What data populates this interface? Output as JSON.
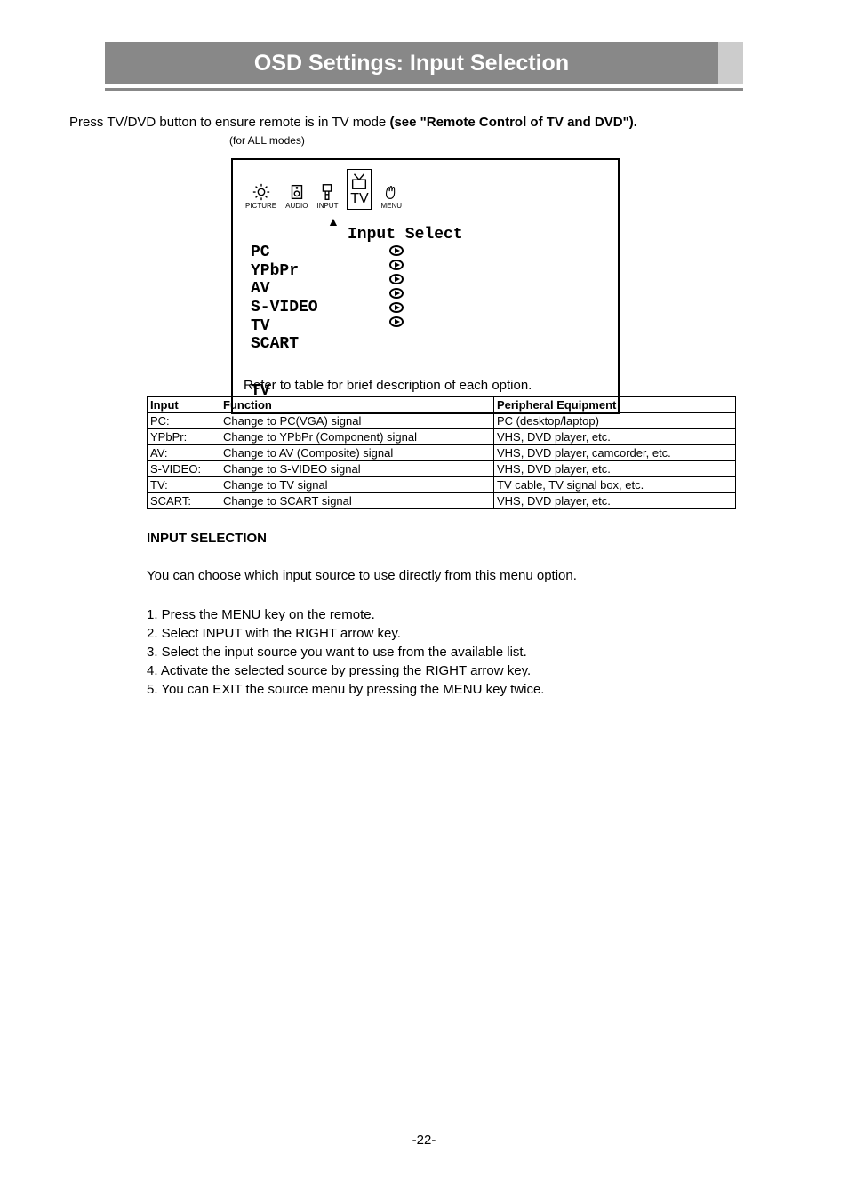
{
  "header": {
    "title": "OSD Settings: Input Selection"
  },
  "intro": {
    "prefix": "Press TV/DVD button to ensure remote is in TV mode ",
    "bold": "(see \"Remote Control of TV and DVD\").",
    "all_modes": "(for ALL modes)"
  },
  "osd": {
    "icons": {
      "picture": "PICTURE",
      "audio": "AUDIO",
      "input": "INPUT",
      "tv": "TV",
      "menu": "MENU"
    },
    "triangle": "▲",
    "heading": "Input Select",
    "items": [
      "PC",
      "YPbPr",
      "AV",
      "S-VIDEO",
      "TV",
      "SCART"
    ],
    "status": "TV"
  },
  "caption": "Refer to table for brief description of each option.",
  "table": {
    "headers": [
      "Input",
      "Function",
      "Peripheral Equipment"
    ],
    "rows": [
      [
        "PC:",
        "Change to PC(VGA) signal",
        "PC (desktop/laptop)"
      ],
      [
        "YPbPr:",
        "Change to YPbPr (Component) signal",
        "VHS, DVD player, etc."
      ],
      [
        "AV:",
        "Change to AV  (Composite) signal",
        "VHS, DVD player, camcorder, etc."
      ],
      [
        "S-VIDEO:",
        "Change to S-VIDEO signal",
        "VHS, DVD player, etc."
      ],
      [
        "TV:",
        "Change to TV signal",
        "TV cable, TV signal box, etc."
      ],
      [
        "SCART:",
        "Change to SCART signal",
        "VHS, DVD player, etc."
      ]
    ]
  },
  "section": {
    "title": "INPUT SELECTION",
    "desc": "You can choose which input source to use directly from this menu option.",
    "steps": [
      "1.  Press the MENU key on the remote.",
      "2.  Select INPUT with the RIGHT arrow key.",
      "3.  Select the input source you want to use from the available list.",
      "4.  Activate the selected source by pressing the RIGHT arrow key.",
      "5.  You can EXIT the source menu by pressing the MENU key twice."
    ]
  },
  "page_number": "-22-"
}
